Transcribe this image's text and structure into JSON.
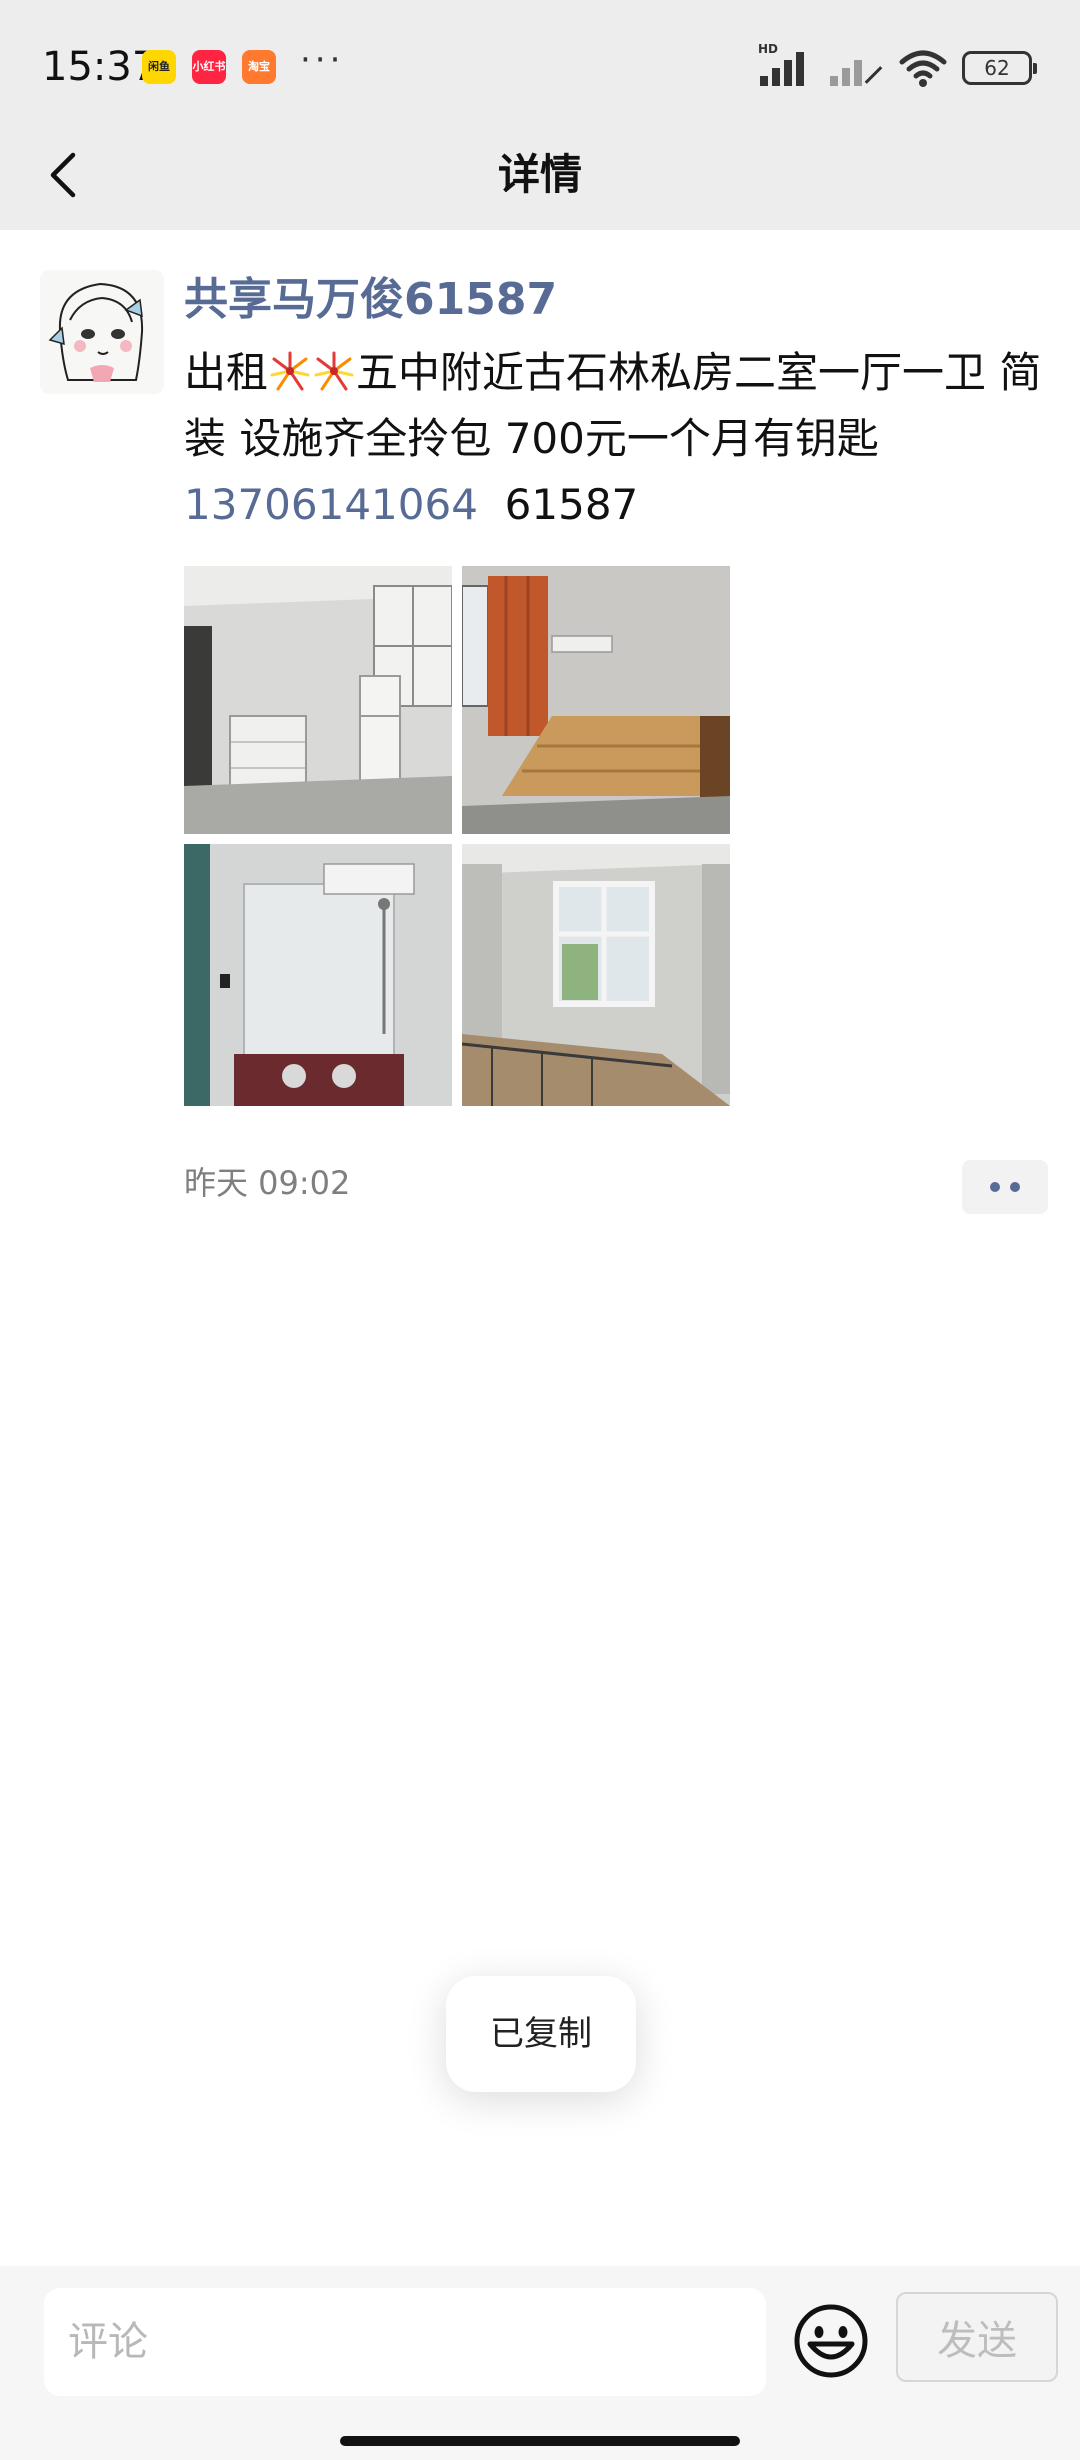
{
  "status_bar": {
    "time": "15:37",
    "app_badges": [
      "闲鱼",
      "小红书",
      "淘宝"
    ],
    "more": "···",
    "hd": "HD",
    "battery": "62"
  },
  "nav": {
    "title": "详情",
    "back_icon": "chevron-left-icon"
  },
  "post": {
    "author": "共享马万俊61587",
    "content_prefix": "出租",
    "content_body": "五中附近古石林私房二室一厅一卫 简装 设施齐全拎包 700元一个月有钥匙",
    "phone": "13706141064",
    "code": "61587",
    "photos": [
      "bedroom-fridge-photo",
      "bed-frame-photo",
      "bathroom-photo",
      "window-room-photo"
    ],
    "time": "昨天 09:02",
    "more_icon": "more-dots-icon"
  },
  "toast": {
    "text": "已复制"
  },
  "comment_bar": {
    "placeholder": "评论",
    "emoji_icon": "smiley-icon",
    "send_label": "发送"
  },
  "colors": {
    "link": "#576b95",
    "bar_bg": "#ededed"
  }
}
